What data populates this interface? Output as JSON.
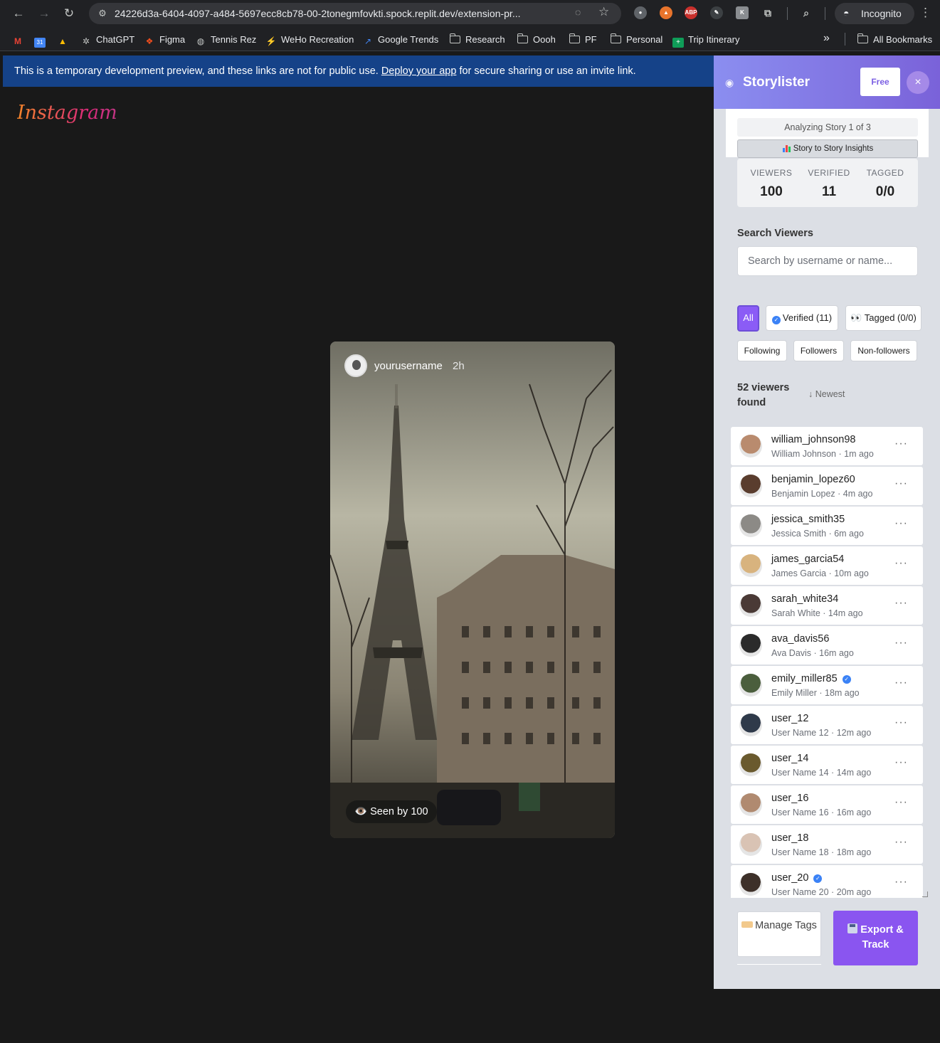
{
  "browser": {
    "url": "24226d3a-6404-4097-a484-5697ecc8cb78-00-2tonegmfovkti.spock.replit.dev/extension-pr...",
    "incognito_label": "Incognito",
    "ext_abp": "ABP",
    "bookmarks": [
      {
        "label": "",
        "icon": "gmail-icon"
      },
      {
        "label": "",
        "icon": "calendar-icon"
      },
      {
        "label": "",
        "icon": "drive-icon"
      },
      {
        "label": "ChatGPT",
        "icon": "chatgpt-icon"
      },
      {
        "label": "Figma",
        "icon": "figma-icon"
      },
      {
        "label": "Tennis Rez",
        "icon": "globe-icon"
      },
      {
        "label": "WeHo Recreation",
        "icon": "weho-icon"
      },
      {
        "label": "Google Trends",
        "icon": "trends-icon"
      },
      {
        "label": "Research",
        "icon": "folder-icon"
      },
      {
        "label": "Oooh",
        "icon": "folder-icon"
      },
      {
        "label": "PF",
        "icon": "folder-icon"
      },
      {
        "label": "Personal",
        "icon": "folder-icon"
      },
      {
        "label": "Trip Itinerary",
        "icon": "sheets-icon"
      }
    ],
    "overflow_label": "»",
    "all_bookmarks": "All Bookmarks"
  },
  "banner": {
    "before": "This is a temporary development preview, and these links are not for public use. ",
    "link": "Deploy your app",
    "after": " for secure sharing or use an invite link."
  },
  "instagram": {
    "logo": "Instagram",
    "story_user": "yourusername",
    "story_time": "2h",
    "seen_by": "Seen by 100"
  },
  "panel": {
    "title": "Storylister",
    "free_label": "Free",
    "close_label": "×",
    "analyzing": "Analyzing Story 1 of 3",
    "insights": "Story to Story Insights",
    "stats": [
      {
        "label": "VIEWERS",
        "value": "100"
      },
      {
        "label": "VERIFIED",
        "value": "11"
      },
      {
        "label": "TAGGED",
        "value": "0/0"
      }
    ],
    "search_label": "Search Viewers",
    "search_placeholder": "Search by username or name...",
    "filters": {
      "all": "All",
      "verified": "Verified (11)",
      "tagged_emoji": "👀",
      "tagged": "Tagged (0/0)",
      "following": "Following",
      "followers": "Followers",
      "non_followers": "Non-followers"
    },
    "found": "52 viewers found",
    "sort": "↓ Newest",
    "viewers": [
      {
        "username": "william_johnson98",
        "sub": "William Johnson · 1m ago",
        "verified": false,
        "color": "#b98b6e"
      },
      {
        "username": "benjamin_lopez60",
        "sub": "Benjamin Lopez · 4m ago",
        "verified": false,
        "color": "#5a3d2e"
      },
      {
        "username": "jessica_smith35",
        "sub": "Jessica Smith · 6m ago",
        "verified": false,
        "color": "#8c8a86"
      },
      {
        "username": "james_garcia54",
        "sub": "James Garcia · 10m ago",
        "verified": false,
        "color": "#d8b37e"
      },
      {
        "username": "sarah_white34",
        "sub": "Sarah White · 14m ago",
        "verified": false,
        "color": "#4a3a36"
      },
      {
        "username": "ava_davis56",
        "sub": "Ava Davis · 16m ago",
        "verified": false,
        "color": "#2b2b2b"
      },
      {
        "username": "emily_miller85",
        "sub": "Emily Miller · 18m ago",
        "verified": true,
        "color": "#4b5e3d"
      },
      {
        "username": "user_12",
        "sub": "User Name 12 · 12m ago",
        "verified": false,
        "color": "#2f3a4a"
      },
      {
        "username": "user_14",
        "sub": "User Name 14 · 14m ago",
        "verified": false,
        "color": "#6a5a2e"
      },
      {
        "username": "user_16",
        "sub": "User Name 16 · 16m ago",
        "verified": false,
        "color": "#b08a70"
      },
      {
        "username": "user_18",
        "sub": "User Name 18 · 18m ago",
        "verified": false,
        "color": "#d9c3b4"
      },
      {
        "username": "user_20",
        "sub": "User Name 20 · 20m ago",
        "verified": true,
        "color": "#3d3029"
      }
    ],
    "manage_tags": "Manage Tags",
    "export": "Export & Track"
  }
}
